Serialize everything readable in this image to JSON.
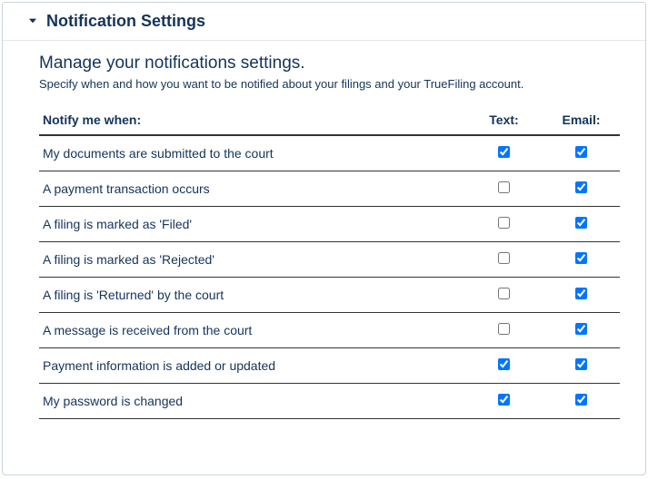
{
  "header": {
    "title": "Notification Settings"
  },
  "section": {
    "subtitle": "Manage your notifications settings.",
    "description": "Specify when and how you want to be notified about your filings and your TrueFiling account."
  },
  "table": {
    "col_event": "Notify me when:",
    "col_text": "Text:",
    "col_email": "Email:",
    "rows": [
      {
        "label": "My documents are submitted to the court",
        "text": true,
        "email": true
      },
      {
        "label": "A payment transaction occurs",
        "text": false,
        "email": true
      },
      {
        "label": "A filing is marked as 'Filed'",
        "text": false,
        "email": true
      },
      {
        "label": "A filing is marked as 'Rejected'",
        "text": false,
        "email": true
      },
      {
        "label": "A filing is 'Returned' by the court",
        "text": false,
        "email": true
      },
      {
        "label": "A message is received from the court",
        "text": false,
        "email": true
      },
      {
        "label": "Payment information is added or updated",
        "text": true,
        "email": true
      },
      {
        "label": "My password is changed",
        "text": true,
        "email": true
      }
    ]
  }
}
